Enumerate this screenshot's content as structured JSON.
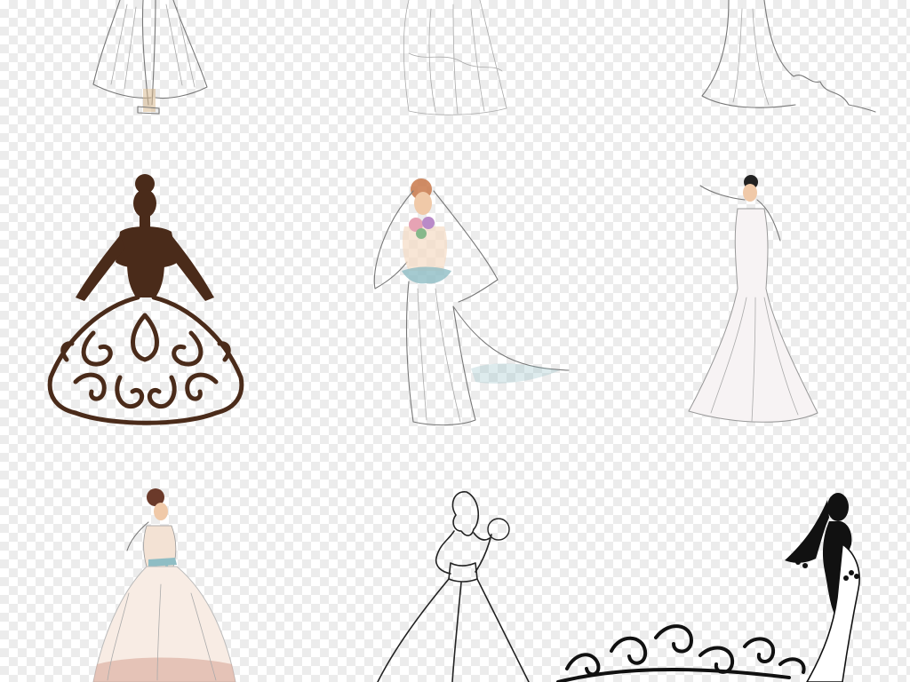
{
  "image": {
    "background": "transparent-checkerboard",
    "colors": {
      "checker_light": "#ffffff",
      "checker_dark": "#ececec",
      "brown_silhouette": "#4a2b1a",
      "black_silhouette": "#111111",
      "sketch_line": "#777777",
      "skin_tone": "#f0c9a8",
      "hair_auburn": "#c9794b",
      "ribbon_teal": "#8fbdc4",
      "lace_pink": "#d9a99a",
      "bouquet_green": "#86b88a"
    },
    "illustrations": [
      {
        "id": "top-left",
        "subject": "bride-legs-sketch"
      },
      {
        "id": "top-center",
        "subject": "gown-skirt-sketch"
      },
      {
        "id": "top-right",
        "subject": "mermaid-train-line-sketch"
      },
      {
        "id": "middle-left",
        "subject": "brown-floral-ballgown-silhouette"
      },
      {
        "id": "middle-center",
        "subject": "veiled-bride-with-bouquet"
      },
      {
        "id": "middle-right",
        "subject": "mermaid-gown-pose-sketch"
      },
      {
        "id": "bottom-left",
        "subject": "ballgown-with-teal-sash"
      },
      {
        "id": "bottom-center",
        "subject": "bride-outline-with-bouquet"
      },
      {
        "id": "bottom-right",
        "subject": "black-veiled-bride-silhouette-with-swirls"
      }
    ]
  }
}
